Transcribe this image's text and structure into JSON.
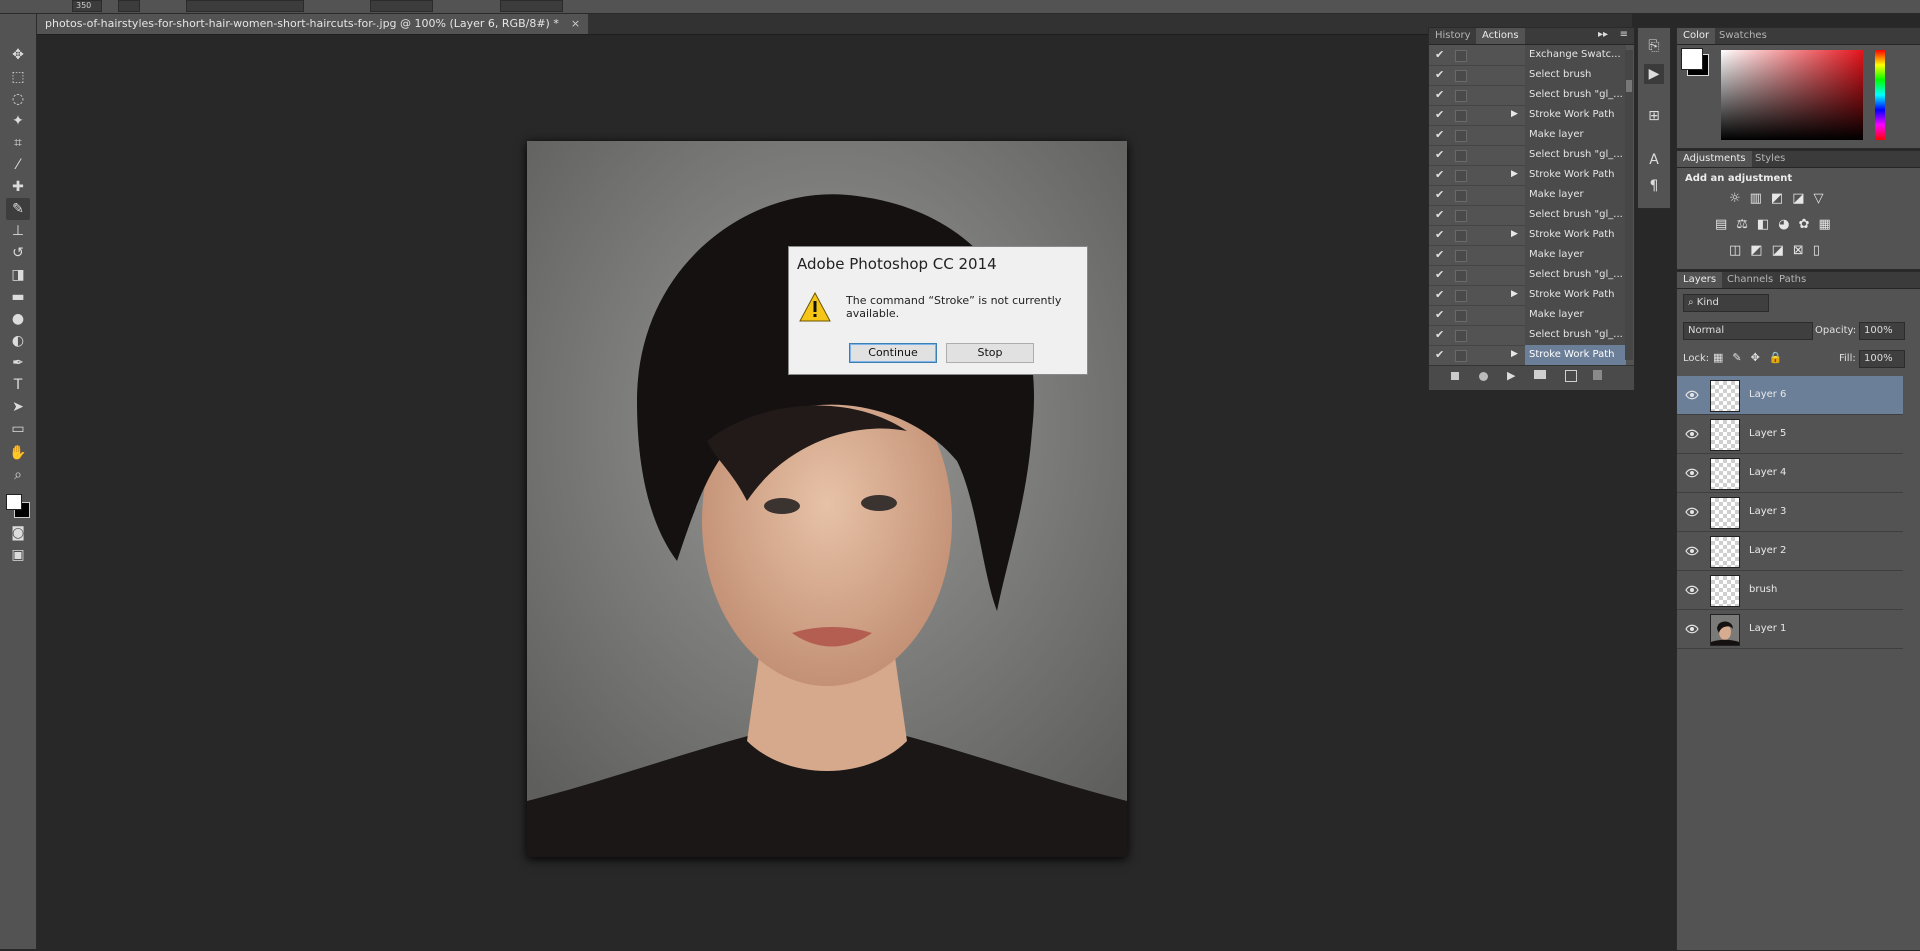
{
  "options_bar": {
    "size_value": "350"
  },
  "document": {
    "tab_title": "photos-of-hairstyles-for-short-hair-women-short-haircuts-for-.jpg @ 100% (Layer 6, RGB/8#) *",
    "close_glyph": "×"
  },
  "tools": [
    "move-icon",
    "marquee-icon",
    "lasso-icon",
    "magic-wand-icon",
    "crop-icon",
    "eyedropper-icon",
    "healing-brush-icon",
    "brush-icon",
    "clone-stamp-icon",
    "history-brush-icon",
    "eraser-icon",
    "gradient-icon",
    "blur-icon",
    "dodge-icon",
    "pen-icon",
    "type-icon",
    "path-selection-icon",
    "rectangle-icon",
    "hand-icon",
    "zoom-icon"
  ],
  "dialog": {
    "title": "Adobe Photoshop CC 2014",
    "message": "The command “Stroke” is not currently available.",
    "continue_label": "Continue",
    "stop_label": "Stop"
  },
  "actions_panel": {
    "tabs": [
      "History",
      "Actions"
    ],
    "active_tab": "Actions",
    "rows": [
      {
        "label": "Exchange Swatc...",
        "expand": false,
        "selected": false
      },
      {
        "label": "Select brush",
        "expand": false,
        "selected": false
      },
      {
        "label": "Select brush \"gl_...",
        "expand": false,
        "selected": false
      },
      {
        "label": "Stroke Work Path",
        "expand": true,
        "selected": false
      },
      {
        "label": "Make layer",
        "expand": false,
        "selected": false
      },
      {
        "label": "Select brush \"gl_...",
        "expand": false,
        "selected": false
      },
      {
        "label": "Stroke Work Path",
        "expand": true,
        "selected": false
      },
      {
        "label": "Make layer",
        "expand": false,
        "selected": false
      },
      {
        "label": "Select brush \"gl_...",
        "expand": false,
        "selected": false
      },
      {
        "label": "Stroke Work Path",
        "expand": true,
        "selected": false
      },
      {
        "label": "Make layer",
        "expand": false,
        "selected": false
      },
      {
        "label": "Select brush \"gl_...",
        "expand": false,
        "selected": false
      },
      {
        "label": "Stroke Work Path",
        "expand": true,
        "selected": false
      },
      {
        "label": "Make layer",
        "expand": false,
        "selected": false
      },
      {
        "label": "Select brush \"gl_...",
        "expand": false,
        "selected": false
      },
      {
        "label": "Stroke Work Path",
        "expand": true,
        "selected": true
      }
    ]
  },
  "color_panel": {
    "tabs": [
      "Color",
      "Swatches"
    ],
    "active_tab": "Color"
  },
  "adjustments_panel": {
    "tabs": [
      "Adjustments",
      "Styles"
    ],
    "active_tab": "Adjustments",
    "heading": "Add an adjustment"
  },
  "layers_panel": {
    "tabs": [
      "Layers",
      "Channels",
      "Paths"
    ],
    "active_tab": "Layers",
    "filter_label": "Kind",
    "blend_mode": "Normal",
    "opacity_label": "Opacity:",
    "opacity_value": "100%",
    "lock_label": "Lock:",
    "fill_label": "Fill:",
    "fill_value": "100%",
    "layers": [
      {
        "name": "Layer 6",
        "selected": true,
        "thumb": "transparent"
      },
      {
        "name": "Layer 5",
        "selected": false,
        "thumb": "transparent"
      },
      {
        "name": "Layer 4",
        "selected": false,
        "thumb": "transparent"
      },
      {
        "name": "Layer 3",
        "selected": false,
        "thumb": "transparent"
      },
      {
        "name": "Layer 2",
        "selected": false,
        "thumb": "transparent"
      },
      {
        "name": "brush",
        "selected": false,
        "thumb": "transparent"
      },
      {
        "name": "Layer 1",
        "selected": false,
        "thumb": "photo"
      }
    ]
  }
}
